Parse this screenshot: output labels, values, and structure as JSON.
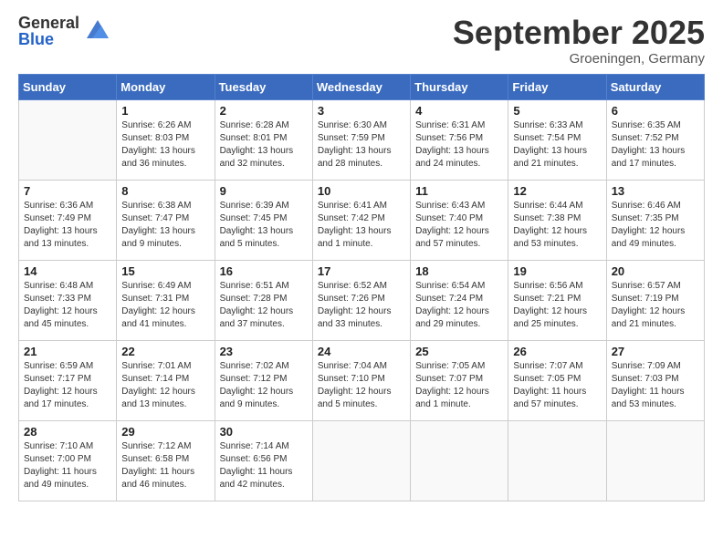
{
  "header": {
    "logo_general": "General",
    "logo_blue": "Blue",
    "month": "September 2025",
    "location": "Groeningen, Germany"
  },
  "days_of_week": [
    "Sunday",
    "Monday",
    "Tuesday",
    "Wednesday",
    "Thursday",
    "Friday",
    "Saturday"
  ],
  "weeks": [
    [
      {
        "day": "",
        "info": ""
      },
      {
        "day": "1",
        "info": "Sunrise: 6:26 AM\nSunset: 8:03 PM\nDaylight: 13 hours\nand 36 minutes."
      },
      {
        "day": "2",
        "info": "Sunrise: 6:28 AM\nSunset: 8:01 PM\nDaylight: 13 hours\nand 32 minutes."
      },
      {
        "day": "3",
        "info": "Sunrise: 6:30 AM\nSunset: 7:59 PM\nDaylight: 13 hours\nand 28 minutes."
      },
      {
        "day": "4",
        "info": "Sunrise: 6:31 AM\nSunset: 7:56 PM\nDaylight: 13 hours\nand 24 minutes."
      },
      {
        "day": "5",
        "info": "Sunrise: 6:33 AM\nSunset: 7:54 PM\nDaylight: 13 hours\nand 21 minutes."
      },
      {
        "day": "6",
        "info": "Sunrise: 6:35 AM\nSunset: 7:52 PM\nDaylight: 13 hours\nand 17 minutes."
      }
    ],
    [
      {
        "day": "7",
        "info": "Sunrise: 6:36 AM\nSunset: 7:49 PM\nDaylight: 13 hours\nand 13 minutes."
      },
      {
        "day": "8",
        "info": "Sunrise: 6:38 AM\nSunset: 7:47 PM\nDaylight: 13 hours\nand 9 minutes."
      },
      {
        "day": "9",
        "info": "Sunrise: 6:39 AM\nSunset: 7:45 PM\nDaylight: 13 hours\nand 5 minutes."
      },
      {
        "day": "10",
        "info": "Sunrise: 6:41 AM\nSunset: 7:42 PM\nDaylight: 13 hours\nand 1 minute."
      },
      {
        "day": "11",
        "info": "Sunrise: 6:43 AM\nSunset: 7:40 PM\nDaylight: 12 hours\nand 57 minutes."
      },
      {
        "day": "12",
        "info": "Sunrise: 6:44 AM\nSunset: 7:38 PM\nDaylight: 12 hours\nand 53 minutes."
      },
      {
        "day": "13",
        "info": "Sunrise: 6:46 AM\nSunset: 7:35 PM\nDaylight: 12 hours\nand 49 minutes."
      }
    ],
    [
      {
        "day": "14",
        "info": "Sunrise: 6:48 AM\nSunset: 7:33 PM\nDaylight: 12 hours\nand 45 minutes."
      },
      {
        "day": "15",
        "info": "Sunrise: 6:49 AM\nSunset: 7:31 PM\nDaylight: 12 hours\nand 41 minutes."
      },
      {
        "day": "16",
        "info": "Sunrise: 6:51 AM\nSunset: 7:28 PM\nDaylight: 12 hours\nand 37 minutes."
      },
      {
        "day": "17",
        "info": "Sunrise: 6:52 AM\nSunset: 7:26 PM\nDaylight: 12 hours\nand 33 minutes."
      },
      {
        "day": "18",
        "info": "Sunrise: 6:54 AM\nSunset: 7:24 PM\nDaylight: 12 hours\nand 29 minutes."
      },
      {
        "day": "19",
        "info": "Sunrise: 6:56 AM\nSunset: 7:21 PM\nDaylight: 12 hours\nand 25 minutes."
      },
      {
        "day": "20",
        "info": "Sunrise: 6:57 AM\nSunset: 7:19 PM\nDaylight: 12 hours\nand 21 minutes."
      }
    ],
    [
      {
        "day": "21",
        "info": "Sunrise: 6:59 AM\nSunset: 7:17 PM\nDaylight: 12 hours\nand 17 minutes."
      },
      {
        "day": "22",
        "info": "Sunrise: 7:01 AM\nSunset: 7:14 PM\nDaylight: 12 hours\nand 13 minutes."
      },
      {
        "day": "23",
        "info": "Sunrise: 7:02 AM\nSunset: 7:12 PM\nDaylight: 12 hours\nand 9 minutes."
      },
      {
        "day": "24",
        "info": "Sunrise: 7:04 AM\nSunset: 7:10 PM\nDaylight: 12 hours\nand 5 minutes."
      },
      {
        "day": "25",
        "info": "Sunrise: 7:05 AM\nSunset: 7:07 PM\nDaylight: 12 hours\nand 1 minute."
      },
      {
        "day": "26",
        "info": "Sunrise: 7:07 AM\nSunset: 7:05 PM\nDaylight: 11 hours\nand 57 minutes."
      },
      {
        "day": "27",
        "info": "Sunrise: 7:09 AM\nSunset: 7:03 PM\nDaylight: 11 hours\nand 53 minutes."
      }
    ],
    [
      {
        "day": "28",
        "info": "Sunrise: 7:10 AM\nSunset: 7:00 PM\nDaylight: 11 hours\nand 49 minutes."
      },
      {
        "day": "29",
        "info": "Sunrise: 7:12 AM\nSunset: 6:58 PM\nDaylight: 11 hours\nand 46 minutes."
      },
      {
        "day": "30",
        "info": "Sunrise: 7:14 AM\nSunset: 6:56 PM\nDaylight: 11 hours\nand 42 minutes."
      },
      {
        "day": "",
        "info": ""
      },
      {
        "day": "",
        "info": ""
      },
      {
        "day": "",
        "info": ""
      },
      {
        "day": "",
        "info": ""
      }
    ]
  ]
}
